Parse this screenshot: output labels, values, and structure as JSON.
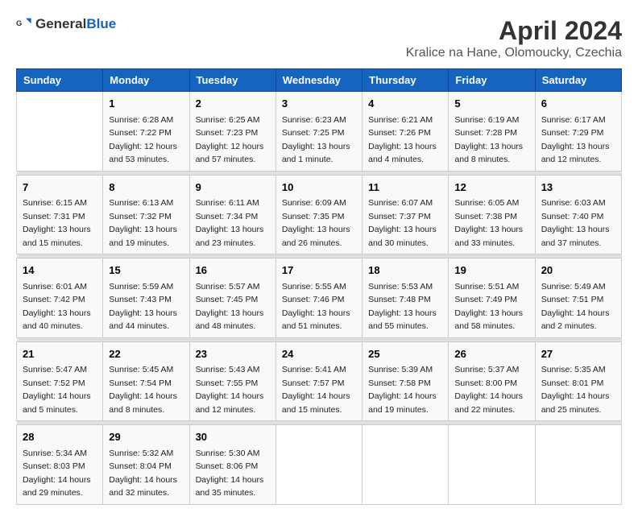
{
  "header": {
    "logo_general": "General",
    "logo_blue": "Blue",
    "title": "April 2024",
    "subtitle": "Kralice na Hane, Olomoucky, Czechia"
  },
  "days_of_week": [
    "Sunday",
    "Monday",
    "Tuesday",
    "Wednesday",
    "Thursday",
    "Friday",
    "Saturday"
  ],
  "weeks": [
    {
      "days": [
        {
          "num": "",
          "content": ""
        },
        {
          "num": "1",
          "content": "Sunrise: 6:28 AM\nSunset: 7:22 PM\nDaylight: 12 hours\nand 53 minutes."
        },
        {
          "num": "2",
          "content": "Sunrise: 6:25 AM\nSunset: 7:23 PM\nDaylight: 12 hours\nand 57 minutes."
        },
        {
          "num": "3",
          "content": "Sunrise: 6:23 AM\nSunset: 7:25 PM\nDaylight: 13 hours\nand 1 minute."
        },
        {
          "num": "4",
          "content": "Sunrise: 6:21 AM\nSunset: 7:26 PM\nDaylight: 13 hours\nand 4 minutes."
        },
        {
          "num": "5",
          "content": "Sunrise: 6:19 AM\nSunset: 7:28 PM\nDaylight: 13 hours\nand 8 minutes."
        },
        {
          "num": "6",
          "content": "Sunrise: 6:17 AM\nSunset: 7:29 PM\nDaylight: 13 hours\nand 12 minutes."
        }
      ]
    },
    {
      "days": [
        {
          "num": "7",
          "content": "Sunrise: 6:15 AM\nSunset: 7:31 PM\nDaylight: 13 hours\nand 15 minutes."
        },
        {
          "num": "8",
          "content": "Sunrise: 6:13 AM\nSunset: 7:32 PM\nDaylight: 13 hours\nand 19 minutes."
        },
        {
          "num": "9",
          "content": "Sunrise: 6:11 AM\nSunset: 7:34 PM\nDaylight: 13 hours\nand 23 minutes."
        },
        {
          "num": "10",
          "content": "Sunrise: 6:09 AM\nSunset: 7:35 PM\nDaylight: 13 hours\nand 26 minutes."
        },
        {
          "num": "11",
          "content": "Sunrise: 6:07 AM\nSunset: 7:37 PM\nDaylight: 13 hours\nand 30 minutes."
        },
        {
          "num": "12",
          "content": "Sunrise: 6:05 AM\nSunset: 7:38 PM\nDaylight: 13 hours\nand 33 minutes."
        },
        {
          "num": "13",
          "content": "Sunrise: 6:03 AM\nSunset: 7:40 PM\nDaylight: 13 hours\nand 37 minutes."
        }
      ]
    },
    {
      "days": [
        {
          "num": "14",
          "content": "Sunrise: 6:01 AM\nSunset: 7:42 PM\nDaylight: 13 hours\nand 40 minutes."
        },
        {
          "num": "15",
          "content": "Sunrise: 5:59 AM\nSunset: 7:43 PM\nDaylight: 13 hours\nand 44 minutes."
        },
        {
          "num": "16",
          "content": "Sunrise: 5:57 AM\nSunset: 7:45 PM\nDaylight: 13 hours\nand 48 minutes."
        },
        {
          "num": "17",
          "content": "Sunrise: 5:55 AM\nSunset: 7:46 PM\nDaylight: 13 hours\nand 51 minutes."
        },
        {
          "num": "18",
          "content": "Sunrise: 5:53 AM\nSunset: 7:48 PM\nDaylight: 13 hours\nand 55 minutes."
        },
        {
          "num": "19",
          "content": "Sunrise: 5:51 AM\nSunset: 7:49 PM\nDaylight: 13 hours\nand 58 minutes."
        },
        {
          "num": "20",
          "content": "Sunrise: 5:49 AM\nSunset: 7:51 PM\nDaylight: 14 hours\nand 2 minutes."
        }
      ]
    },
    {
      "days": [
        {
          "num": "21",
          "content": "Sunrise: 5:47 AM\nSunset: 7:52 PM\nDaylight: 14 hours\nand 5 minutes."
        },
        {
          "num": "22",
          "content": "Sunrise: 5:45 AM\nSunset: 7:54 PM\nDaylight: 14 hours\nand 8 minutes."
        },
        {
          "num": "23",
          "content": "Sunrise: 5:43 AM\nSunset: 7:55 PM\nDaylight: 14 hours\nand 12 minutes."
        },
        {
          "num": "24",
          "content": "Sunrise: 5:41 AM\nSunset: 7:57 PM\nDaylight: 14 hours\nand 15 minutes."
        },
        {
          "num": "25",
          "content": "Sunrise: 5:39 AM\nSunset: 7:58 PM\nDaylight: 14 hours\nand 19 minutes."
        },
        {
          "num": "26",
          "content": "Sunrise: 5:37 AM\nSunset: 8:00 PM\nDaylight: 14 hours\nand 22 minutes."
        },
        {
          "num": "27",
          "content": "Sunrise: 5:35 AM\nSunset: 8:01 PM\nDaylight: 14 hours\nand 25 minutes."
        }
      ]
    },
    {
      "days": [
        {
          "num": "28",
          "content": "Sunrise: 5:34 AM\nSunset: 8:03 PM\nDaylight: 14 hours\nand 29 minutes."
        },
        {
          "num": "29",
          "content": "Sunrise: 5:32 AM\nSunset: 8:04 PM\nDaylight: 14 hours\nand 32 minutes."
        },
        {
          "num": "30",
          "content": "Sunrise: 5:30 AM\nSunset: 8:06 PM\nDaylight: 14 hours\nand 35 minutes."
        },
        {
          "num": "",
          "content": ""
        },
        {
          "num": "",
          "content": ""
        },
        {
          "num": "",
          "content": ""
        },
        {
          "num": "",
          "content": ""
        }
      ]
    }
  ]
}
